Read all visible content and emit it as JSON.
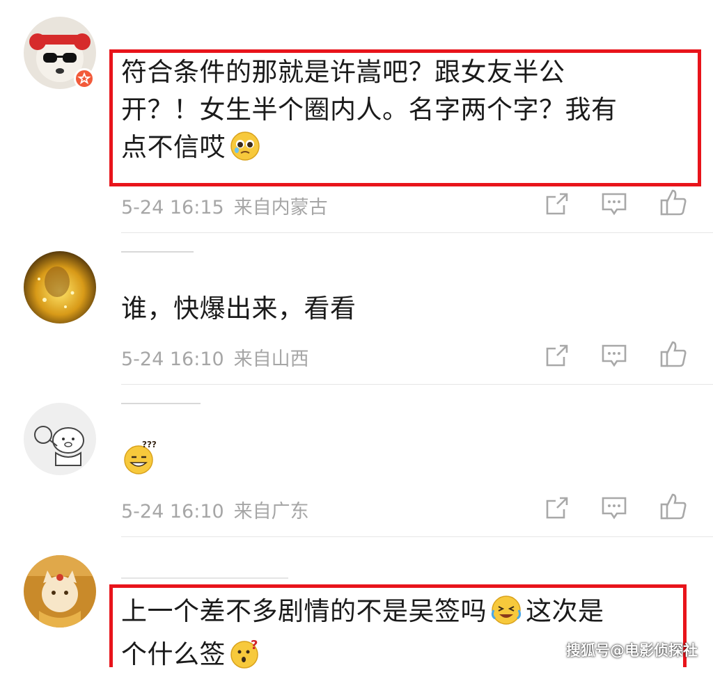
{
  "comments": [
    {
      "text_lines": [
        "符合条件的那就是许嵩吧？跟女友半公",
        "开？！女生半个圈内人。名字两个字？我有",
        "点不信哎"
      ],
      "emoji": "pleading-face-emoji",
      "time": "5-24 16:15",
      "location": "来自内蒙古",
      "highlighted": true
    },
    {
      "text_lines": [
        "谁，快爆出来，看看"
      ],
      "time": "5-24 16:10",
      "location": "来自山西",
      "highlighted": false
    },
    {
      "text_lines": [],
      "emoji": "confused-grin-emoji",
      "time": "5-24 16:10",
      "location": "来自广东",
      "highlighted": false
    },
    {
      "text_lines": [
        "上一个差不多剧情的不是吴签吗",
        "这次是",
        "个什么签"
      ],
      "emojis": [
        "laughing-crying-emoji",
        "surprised-question-emoji"
      ],
      "highlighted": true
    }
  ],
  "actions": {
    "share_icon": "share-icon",
    "comment_icon": "comment-icon",
    "like_icon": "thumbs-up-icon"
  },
  "watermark": "搜狐号@电影侦探社",
  "colors": {
    "highlight_box": "#e8141b",
    "meta_text": "#a6a6a6",
    "vip_badge": "#f25a3a"
  }
}
